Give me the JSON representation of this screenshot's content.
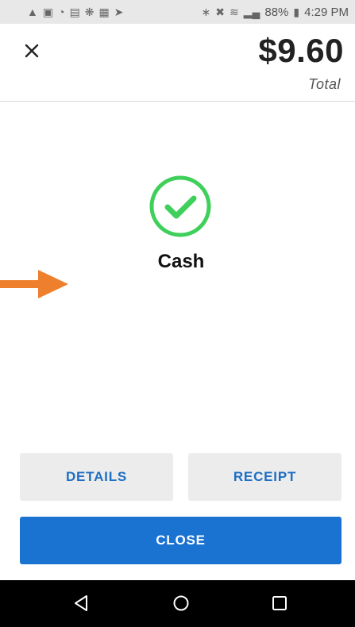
{
  "status_bar": {
    "left_icons": [
      "warning-icon",
      "screenshot-icon",
      "speedometer-icon",
      "gallery-icon",
      "pinwheel-icon",
      "document-icon",
      "send-icon"
    ],
    "right_icons": [
      "bluetooth-icon",
      "mute-icon",
      "wifi-icon",
      "signal-icon",
      "battery-icon"
    ],
    "battery_percent": "88%",
    "time": "4:29 PM"
  },
  "header": {
    "total_amount": "$9.60",
    "total_label": "Total"
  },
  "result": {
    "icon": "check-circle-icon",
    "method_label": "Cash"
  },
  "actions": {
    "details_label": "DETAILS",
    "receipt_label": "RECEIPT",
    "close_label": "CLOSE"
  },
  "nav_bar": {
    "icons": [
      "back-icon",
      "home-icon",
      "recents-icon"
    ]
  },
  "colors": {
    "accent_blue": "#1a72d1",
    "link_blue": "#1d6fc4",
    "success_green": "#3fcf5b",
    "annotation_orange": "#ee7f2d",
    "status_bar_bg": "#e8e8e8",
    "nav_bar_bg": "#000000"
  }
}
